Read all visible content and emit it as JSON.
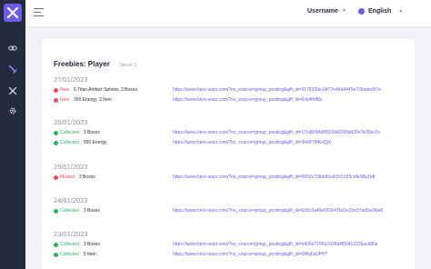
{
  "colors": {
    "sidebar": "#262a3d",
    "accent": "#6c5ce7",
    "new": "#e84a5f",
    "collected": "#27b36a",
    "missed": "#e84a5f"
  },
  "sidebar": {
    "items": [
      {
        "icon": "link-icon"
      },
      {
        "icon": "sword-icon"
      },
      {
        "icon": "crossed-swords-icon"
      },
      {
        "icon": "gear-icon"
      }
    ]
  },
  "header": {
    "user_label": "Username",
    "language_label": "English"
  },
  "card": {
    "title": "Freebies: Player",
    "server": "Server 1"
  },
  "days": [
    {
      "date": "27/01/2023",
      "entries": [
        {
          "status": "New",
          "reward": "5 Titan Artifact Sphere, 3 Boxes",
          "link": "https://www.hero-wars.com/?nx_source=group_posting&gift_id=0178339e1f477e46d4445e726aabd57e"
        },
        {
          "status": "New",
          "reward": "300 Energy, 3 Item",
          "link": "https://www.hero-wars.com/?nx_source=group_posting&gift_id=6dy4fhfl8x"
        }
      ]
    },
    {
      "date": "26/01/2023",
      "entries": [
        {
          "status": "Collected",
          "reward": "3 Boxes",
          "link": "https://www.hero-wars.com/?nx_source=group_posting&gift_id=17cd80bfd85539d0289dd20e7b95ec5c"
        },
        {
          "status": "Collected",
          "reward": "500 Energy",
          "link": "https://www.hero-wars.com/?nx_source=group_posting&gift_id=0mt8TMKnQjX"
        }
      ]
    },
    {
      "date": "25/01/2023",
      "entries": [
        {
          "status": "Missed",
          "reward": "3 Boxes",
          "link": "https://www.hero-wars.com/?nx_source=group_posting&gift_id=0650c71bdd6ceb2c5155cefe98a1fdf"
        }
      ]
    },
    {
      "date": "24/01/2023",
      "entries": [
        {
          "status": "Collected",
          "reward": "3 Boxes",
          "link": "https://www.hero-wars.com/?nx_source=group_posting&gift_id=b36c3a49e081647bc5e23e57ad5e0fae0"
        }
      ]
    },
    {
      "date": "23/01/2023",
      "entries": [
        {
          "status": "Collected",
          "reward": "3 Boxes",
          "link": "https://www.hero-wars.com/?nx_source=group_posting&gift_id=b430e7295e2d36d4f564c2226acd95e"
        },
        {
          "status": "Collected",
          "reward": "5 Item",
          "link": "https://www.hero-wars.com/?nx_source=group_posting&gift_id=t9RgGjUPH7"
        }
      ]
    }
  ]
}
